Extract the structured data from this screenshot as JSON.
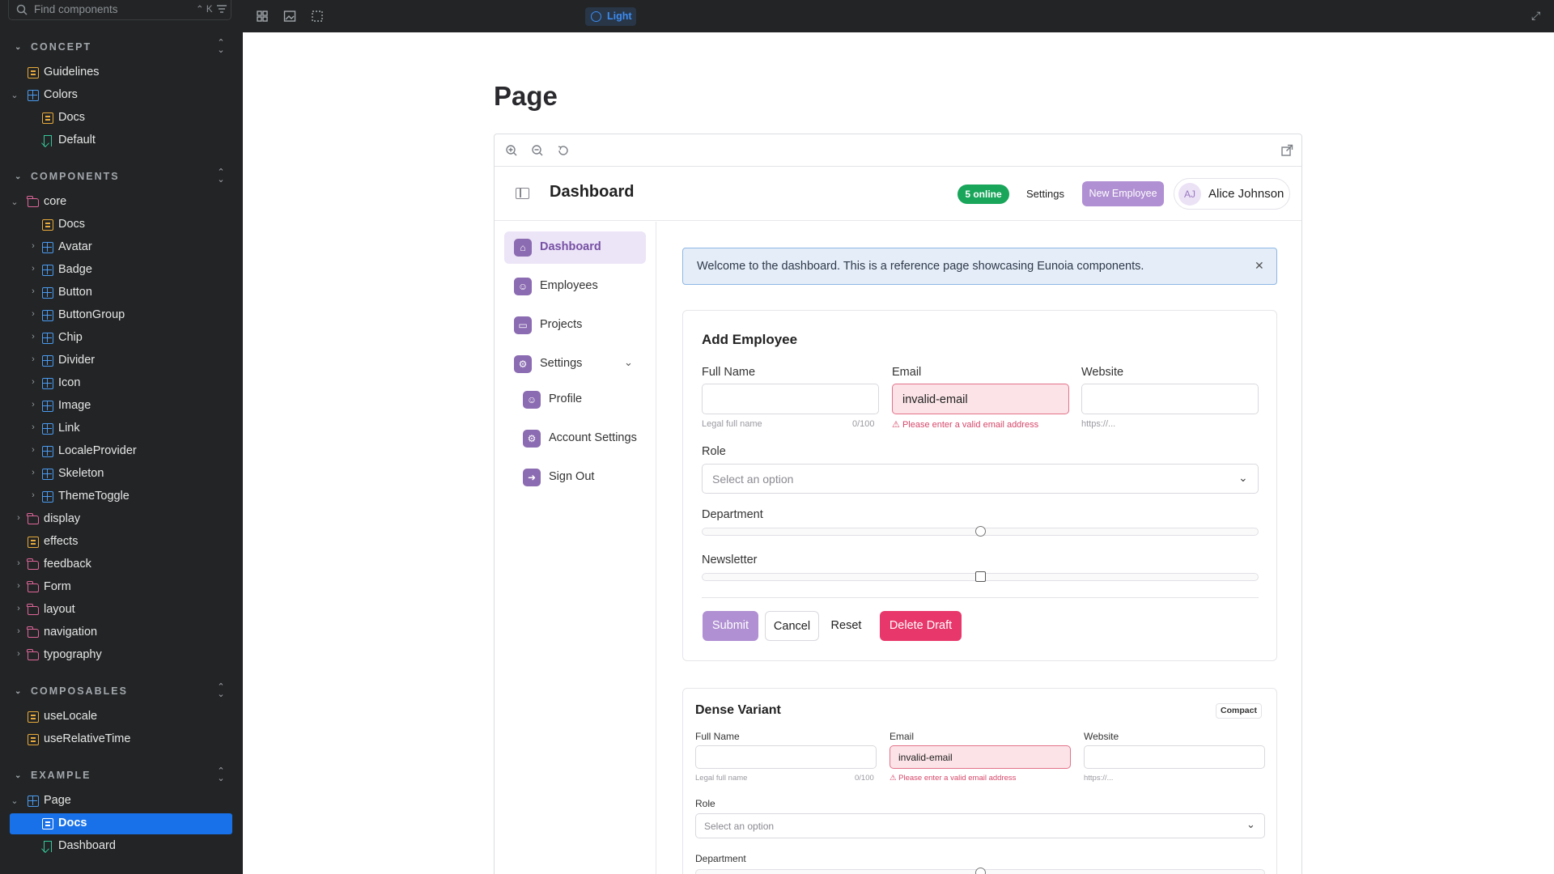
{
  "sidebar": {
    "search_placeholder": "Find components",
    "search_shortcut": "⌃ K",
    "sections": {
      "concept": "CONCEPT",
      "components": "COMPONENTS",
      "composables": "COMPOSABLES",
      "example": "EXAMPLE"
    },
    "tree": {
      "guidelines": "Guidelines",
      "colors": "Colors",
      "colors_docs": "Docs",
      "colors_default": "Default",
      "core": "core",
      "core_docs": "Docs",
      "avatar": "Avatar",
      "badge": "Badge",
      "button": "Button",
      "buttongroup": "ButtonGroup",
      "chip": "Chip",
      "divider": "Divider",
      "icon": "Icon",
      "image": "Image",
      "link": "Link",
      "localeprovider": "LocaleProvider",
      "skeleton": "Skeleton",
      "themetoggle": "ThemeToggle",
      "display": "display",
      "effects": "effects",
      "feedback": "feedback",
      "form": "Form",
      "layout": "layout",
      "navigation": "navigation",
      "typography": "typography",
      "uselocale": "useLocale",
      "userelativetime": "useRelativeTime",
      "page": "Page",
      "page_docs": "Docs",
      "page_dashboard": "Dashboard"
    }
  },
  "toolbar": {
    "theme_label": "Light"
  },
  "canvas": {
    "page_title": "Page"
  },
  "app": {
    "title": "Dashboard",
    "online_badge": "5 online",
    "settings_label": "Settings",
    "new_employee_label": "New Employee",
    "user": {
      "initials": "AJ",
      "name": "Alice Johnson"
    },
    "nav": {
      "dashboard": "Dashboard",
      "employees": "Employees",
      "projects": "Projects",
      "settings": "Settings",
      "profile": "Profile",
      "account_settings": "Account Settings",
      "sign_out": "Sign Out"
    },
    "alert": "Welcome to the dashboard. This is a reference page showcasing Eunoia components.",
    "form": {
      "title": "Add Employee",
      "full_name_label": "Full Name",
      "full_name_help": "Legal full name",
      "full_name_count": "0/100",
      "email_label": "Email",
      "email_value": "invalid-email",
      "email_error": "Please enter a valid email address",
      "website_label": "Website",
      "website_help": "https://...",
      "role_label": "Role",
      "role_placeholder": "Select an option",
      "department_label": "Department",
      "newsletter_label": "Newsletter",
      "submit": "Submit",
      "cancel": "Cancel",
      "reset": "Reset",
      "delete_draft": "Delete Draft"
    },
    "dense": {
      "title": "Dense Variant",
      "badge": "Compact",
      "full_name_label": "Full Name",
      "full_name_help": "Legal full name",
      "full_name_count": "0/100",
      "email_label": "Email",
      "email_value": "invalid-email",
      "email_error": "Please enter a valid email address",
      "website_label": "Website",
      "website_help": "https://...",
      "role_label": "Role",
      "role_placeholder": "Select an option",
      "department_label": "Department"
    }
  },
  "colors": {
    "sidebar_bg": "#222425",
    "selected": "#1871e8",
    "accent_purple": "#b08fd2",
    "online_green": "#19a55a",
    "danger": "#e8376a"
  }
}
